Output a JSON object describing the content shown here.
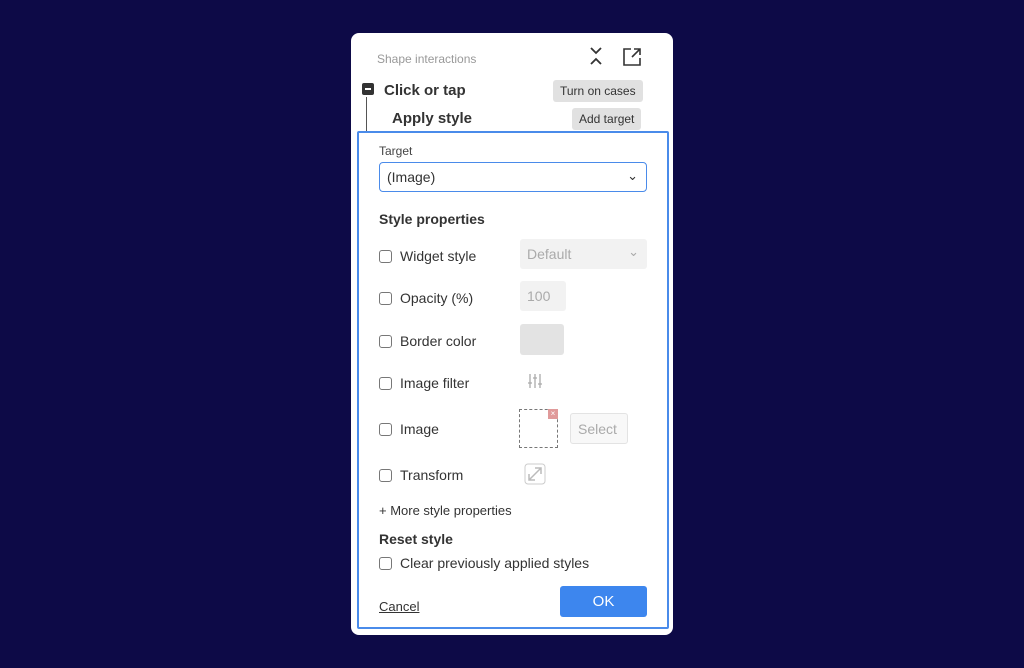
{
  "header": {
    "title": "Shape interactions",
    "collapse_icon": "collapse-icon",
    "popout_icon": "external-link-icon"
  },
  "event": {
    "label": "Click or tap",
    "turn_on_cases": "Turn on cases"
  },
  "action": {
    "label": "Apply style",
    "add_target": "Add target"
  },
  "target": {
    "label": "Target",
    "value": "(Image)"
  },
  "style": {
    "heading": "Style properties",
    "widget_style": "Widget style",
    "widget_style_value": "Default",
    "opacity": "Opacity (%)",
    "opacity_value": "100",
    "border_color": "Border color",
    "image_filter": "Image filter",
    "image": "Image",
    "select": "Select",
    "transform": "Transform",
    "more": "+ More style properties"
  },
  "reset": {
    "heading": "Reset style",
    "clear": "Clear previously applied styles"
  },
  "footer": {
    "cancel": "Cancel",
    "ok": "OK"
  },
  "colors": {
    "accent": "#3d86ee",
    "background": "#0d0a47"
  }
}
